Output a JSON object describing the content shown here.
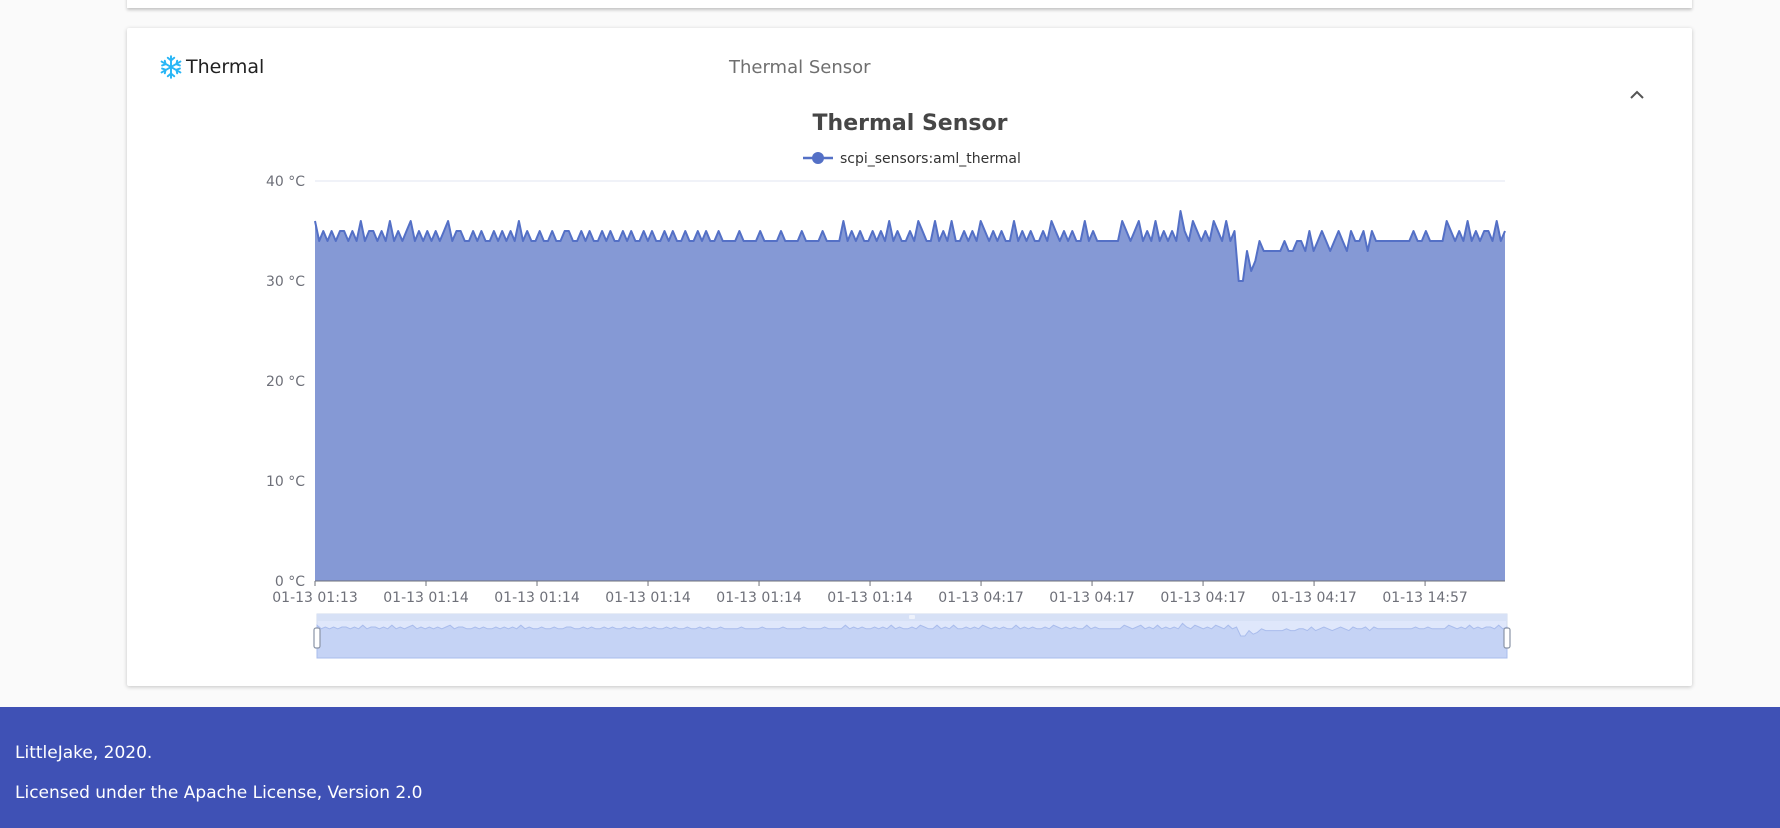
{
  "panel": {
    "title": "Thermal",
    "description": "Thermal Sensor",
    "icon": "snowflake-icon",
    "collapse_icon": "chevron-up-icon",
    "accent_color": "#29b6f6"
  },
  "chart_data": {
    "type": "area",
    "title": "Thermal Sensor",
    "xlabel": "",
    "ylabel": "",
    "ylim": [
      0,
      40
    ],
    "y_ticks": [
      "0 °C",
      "10 °C",
      "20 °C",
      "30 °C",
      "40 °C"
    ],
    "x_ticks": [
      "01-13 01:13",
      "01-13 01:14",
      "01-13 01:14",
      "01-13 01:14",
      "01-13 01:14",
      "01-13 01:14",
      "01-13 04:17",
      "01-13 04:17",
      "01-13 04:17",
      "01-13 04:17",
      "01-13 14:57"
    ],
    "legend": "top-center",
    "grid": true,
    "colors": {
      "line": "#5470c6",
      "area": "#8599d5",
      "zoom_fill": "#dfe7fb"
    },
    "series": [
      {
        "name": "scpi_sensors:aml_thermal",
        "values": [
          36,
          34,
          35,
          34,
          35,
          34,
          35,
          35,
          34,
          35,
          34,
          36,
          34,
          35,
          35,
          34,
          35,
          34,
          36,
          34,
          35,
          34,
          35,
          36,
          34,
          35,
          34,
          35,
          34,
          35,
          34,
          35,
          36,
          34,
          35,
          35,
          34,
          34,
          35,
          34,
          35,
          34,
          34,
          35,
          34,
          35,
          34,
          35,
          34,
          36,
          34,
          35,
          34,
          34,
          35,
          34,
          34,
          35,
          34,
          34,
          35,
          35,
          34,
          34,
          35,
          34,
          35,
          34,
          34,
          35,
          34,
          35,
          34,
          34,
          35,
          34,
          35,
          34,
          34,
          35,
          34,
          35,
          34,
          34,
          35,
          34,
          35,
          34,
          34,
          35,
          34,
          34,
          35,
          34,
          35,
          34,
          34,
          35,
          34,
          34,
          34,
          34,
          35,
          34,
          34,
          34,
          34,
          35,
          34,
          34,
          34,
          34,
          35,
          34,
          34,
          34,
          34,
          35,
          34,
          34,
          34,
          34,
          35,
          34,
          34,
          34,
          34,
          36,
          34,
          35,
          34,
          35,
          34,
          34,
          35,
          34,
          35,
          34,
          36,
          34,
          35,
          34,
          34,
          35,
          34,
          36,
          35,
          34,
          34,
          36,
          34,
          35,
          34,
          36,
          34,
          34,
          35,
          34,
          35,
          34,
          36,
          35,
          34,
          35,
          34,
          35,
          34,
          34,
          36,
          34,
          35,
          34,
          35,
          34,
          34,
          35,
          34,
          36,
          35,
          34,
          35,
          34,
          35,
          34,
          34,
          36,
          34,
          35,
          34,
          34,
          34,
          34,
          34,
          34,
          36,
          35,
          34,
          35,
          36,
          34,
          35,
          34,
          36,
          34,
          35,
          34,
          35,
          34,
          37,
          35,
          34,
          36,
          35,
          34,
          35,
          34,
          36,
          35,
          34,
          36,
          34,
          35,
          30,
          30,
          33,
          31,
          32,
          34,
          33,
          33,
          33,
          33,
          33,
          34,
          33,
          33,
          34,
          34,
          33,
          35,
          33,
          34,
          35,
          34,
          33,
          34,
          35,
          34,
          33,
          35,
          34,
          34,
          35,
          33,
          35,
          34,
          34,
          34,
          34,
          34,
          34,
          34,
          34,
          34,
          35,
          34,
          34,
          35,
          34,
          34,
          34,
          34,
          36,
          35,
          34,
          35,
          34,
          36,
          34,
          35,
          34,
          35,
          35,
          34,
          36,
          34,
          35
        ]
      }
    ]
  },
  "footer": {
    "line1": "LittleJake, 2020.",
    "line2": "Licensed under the Apache License, Version 2.0"
  }
}
